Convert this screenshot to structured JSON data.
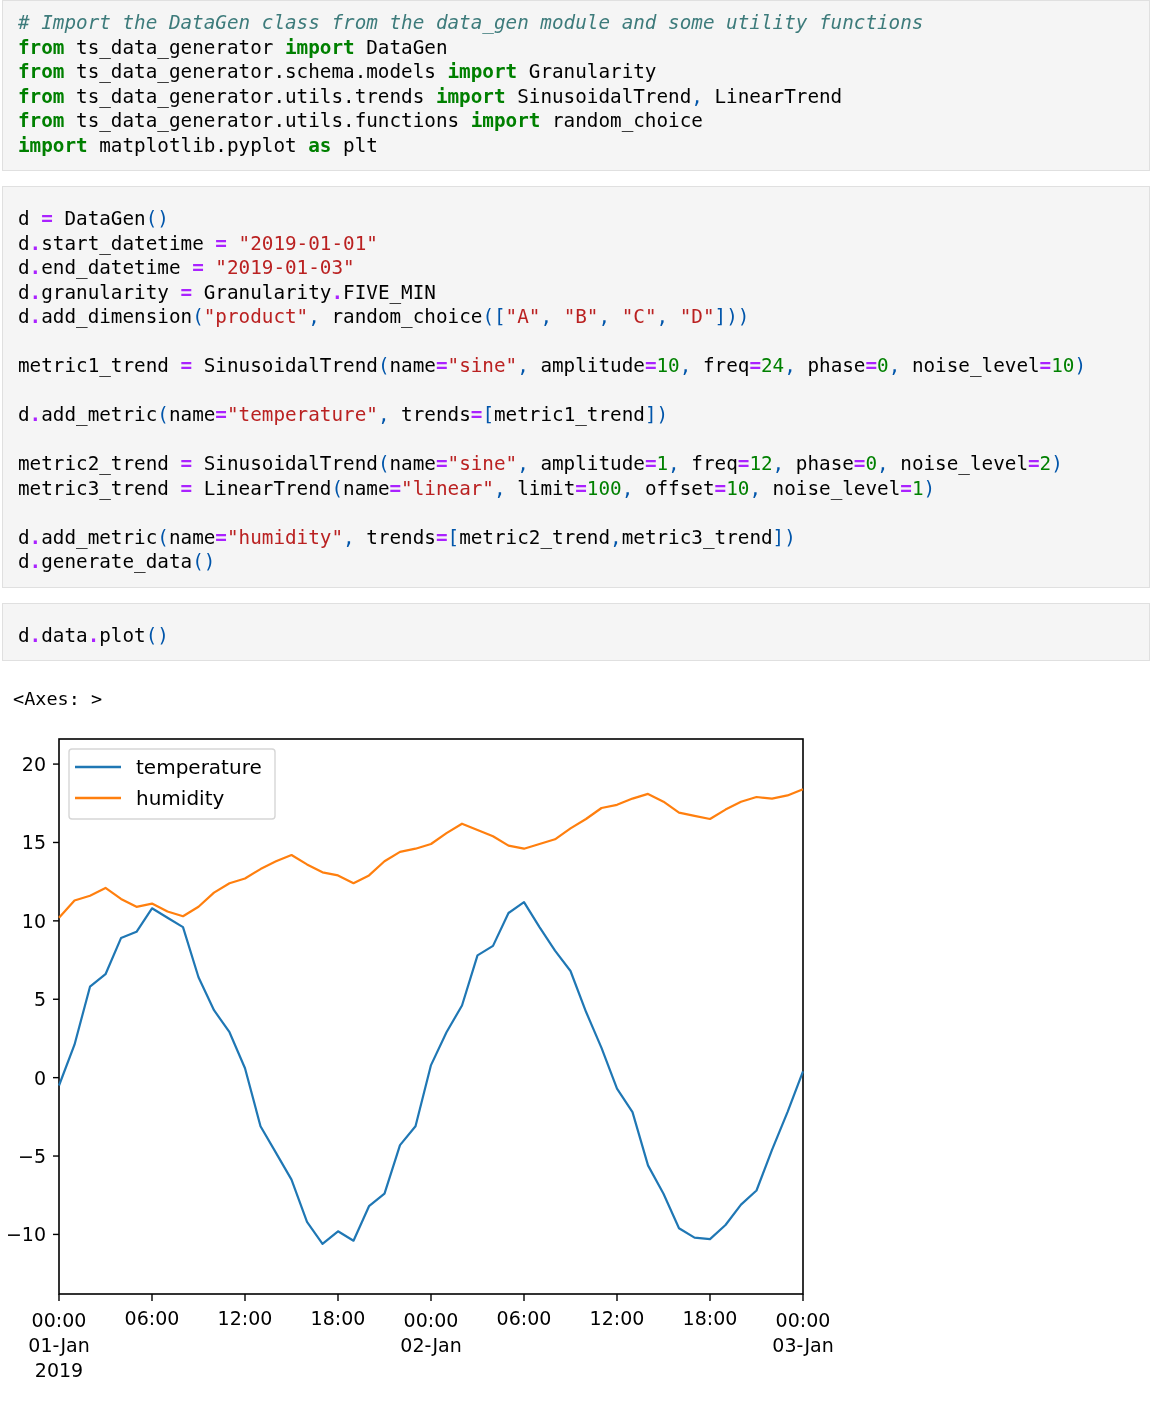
{
  "cells": [
    {
      "blocks": [
        {
          "lines": [
            [
              {
                "kind": "comment",
                "text": "# Import the DataGen class from the data_gen module and some utility functions"
              }
            ],
            [
              {
                "kind": "kw",
                "text": "from"
              },
              {
                "kind": "plain",
                "text": " ts_data_generator "
              },
              {
                "kind": "kw",
                "text": "import"
              },
              {
                "kind": "plain",
                "text": " DataGen"
              }
            ],
            [
              {
                "kind": "kw",
                "text": "from"
              },
              {
                "kind": "plain",
                "text": " ts_data_generator.schema.models "
              },
              {
                "kind": "kw",
                "text": "import"
              },
              {
                "kind": "plain",
                "text": " Granularity"
              }
            ],
            [
              {
                "kind": "kw",
                "text": "from"
              },
              {
                "kind": "plain",
                "text": " ts_data_generator.utils.trends "
              },
              {
                "kind": "kw",
                "text": "import"
              },
              {
                "kind": "plain",
                "text": " SinusoidalTrend"
              },
              {
                "kind": "paren",
                "text": ", "
              },
              {
                "kind": "plain",
                "text": "LinearTrend"
              }
            ],
            [
              {
                "kind": "kw",
                "text": "from"
              },
              {
                "kind": "plain",
                "text": " ts_data_generator.utils.functions "
              },
              {
                "kind": "kw",
                "text": "import"
              },
              {
                "kind": "plain",
                "text": " random_choice"
              }
            ],
            [
              {
                "kind": "kw",
                "text": "import"
              },
              {
                "kind": "plain",
                "text": " matplotlib.pyplot "
              },
              {
                "kind": "kw",
                "text": "as"
              },
              {
                "kind": "plain",
                "text": " plt"
              }
            ]
          ]
        }
      ]
    },
    {
      "blocks": [
        {
          "lines": [
            [
              {
                "kind": "plain",
                "text": "d "
              },
              {
                "kind": "op",
                "text": "="
              },
              {
                "kind": "plain",
                "text": " DataGen"
              },
              {
                "kind": "paren",
                "text": "()"
              }
            ],
            [
              {
                "kind": "plain",
                "text": "d"
              },
              {
                "kind": "op",
                "text": "."
              },
              {
                "kind": "plain",
                "text": "start_datetime "
              },
              {
                "kind": "op",
                "text": "="
              },
              {
                "kind": "str",
                "text": " \"2019-01-01\""
              }
            ],
            [
              {
                "kind": "plain",
                "text": "d"
              },
              {
                "kind": "op",
                "text": "."
              },
              {
                "kind": "plain",
                "text": "end_datetime "
              },
              {
                "kind": "op",
                "text": "="
              },
              {
                "kind": "str",
                "text": " \"2019-01-03\""
              }
            ],
            [
              {
                "kind": "plain",
                "text": "d"
              },
              {
                "kind": "op",
                "text": "."
              },
              {
                "kind": "plain",
                "text": "granularity "
              },
              {
                "kind": "op",
                "text": "="
              },
              {
                "kind": "plain",
                "text": " Granularity"
              },
              {
                "kind": "op",
                "text": "."
              },
              {
                "kind": "plain",
                "text": "FIVE_MIN"
              }
            ],
            [
              {
                "kind": "plain",
                "text": "d"
              },
              {
                "kind": "op",
                "text": "."
              },
              {
                "kind": "plain",
                "text": "add_dimension"
              },
              {
                "kind": "paren",
                "text": "("
              },
              {
                "kind": "str",
                "text": "\"product\""
              },
              {
                "kind": "paren",
                "text": ", "
              },
              {
                "kind": "plain",
                "text": "random_choice"
              },
              {
                "kind": "paren",
                "text": "(["
              },
              {
                "kind": "str",
                "text": "\"A\""
              },
              {
                "kind": "paren",
                "text": ", "
              },
              {
                "kind": "str",
                "text": "\"B\""
              },
              {
                "kind": "paren",
                "text": ", "
              },
              {
                "kind": "str",
                "text": "\"C\""
              },
              {
                "kind": "paren",
                "text": ", "
              },
              {
                "kind": "str",
                "text": "\"D\""
              },
              {
                "kind": "paren",
                "text": "]))"
              }
            ]
          ]
        },
        {
          "lines": [
            [
              {
                "kind": "plain",
                "text": "metric1_trend "
              },
              {
                "kind": "op",
                "text": "="
              },
              {
                "kind": "plain",
                "text": " SinusoidalTrend"
              },
              {
                "kind": "paren",
                "text": "("
              },
              {
                "kind": "plain",
                "text": "name"
              },
              {
                "kind": "op",
                "text": "="
              },
              {
                "kind": "str",
                "text": "\"sine\""
              },
              {
                "kind": "paren",
                "text": ", "
              },
              {
                "kind": "plain",
                "text": "amplitude"
              },
              {
                "kind": "op",
                "text": "="
              },
              {
                "kind": "num",
                "text": "10"
              },
              {
                "kind": "paren",
                "text": ", "
              },
              {
                "kind": "plain",
                "text": "freq"
              },
              {
                "kind": "op",
                "text": "="
              },
              {
                "kind": "num",
                "text": "24"
              },
              {
                "kind": "paren",
                "text": ", "
              },
              {
                "kind": "plain",
                "text": "phase"
              },
              {
                "kind": "op",
                "text": "="
              },
              {
                "kind": "num",
                "text": "0"
              },
              {
                "kind": "paren",
                "text": ", "
              },
              {
                "kind": "plain",
                "text": "noise_level"
              },
              {
                "kind": "op",
                "text": "="
              },
              {
                "kind": "num",
                "text": "10"
              },
              {
                "kind": "paren",
                "text": ")"
              }
            ]
          ]
        },
        {
          "lines": [
            [
              {
                "kind": "plain",
                "text": "d"
              },
              {
                "kind": "op",
                "text": "."
              },
              {
                "kind": "plain",
                "text": "add_metric"
              },
              {
                "kind": "paren",
                "text": "("
              },
              {
                "kind": "plain",
                "text": "name"
              },
              {
                "kind": "op",
                "text": "="
              },
              {
                "kind": "str",
                "text": "\"temperature\""
              },
              {
                "kind": "paren",
                "text": ", "
              },
              {
                "kind": "plain",
                "text": "trends"
              },
              {
                "kind": "op",
                "text": "="
              },
              {
                "kind": "paren",
                "text": "["
              },
              {
                "kind": "plain",
                "text": "metric1_trend"
              },
              {
                "kind": "paren",
                "text": "])"
              }
            ]
          ]
        },
        {
          "lines": [
            [
              {
                "kind": "plain",
                "text": "metric2_trend "
              },
              {
                "kind": "op",
                "text": "="
              },
              {
                "kind": "plain",
                "text": " SinusoidalTrend"
              },
              {
                "kind": "paren",
                "text": "("
              },
              {
                "kind": "plain",
                "text": "name"
              },
              {
                "kind": "op",
                "text": "="
              },
              {
                "kind": "str",
                "text": "\"sine\""
              },
              {
                "kind": "paren",
                "text": ", "
              },
              {
                "kind": "plain",
                "text": "amplitude"
              },
              {
                "kind": "op",
                "text": "="
              },
              {
                "kind": "num",
                "text": "1"
              },
              {
                "kind": "paren",
                "text": ", "
              },
              {
                "kind": "plain",
                "text": "freq"
              },
              {
                "kind": "op",
                "text": "="
              },
              {
                "kind": "num",
                "text": "12"
              },
              {
                "kind": "paren",
                "text": ", "
              },
              {
                "kind": "plain",
                "text": "phase"
              },
              {
                "kind": "op",
                "text": "="
              },
              {
                "kind": "num",
                "text": "0"
              },
              {
                "kind": "paren",
                "text": ", "
              },
              {
                "kind": "plain",
                "text": "noise_level"
              },
              {
                "kind": "op",
                "text": "="
              },
              {
                "kind": "num",
                "text": "2"
              },
              {
                "kind": "paren",
                "text": ")"
              }
            ],
            [
              {
                "kind": "plain",
                "text": "metric3_trend "
              },
              {
                "kind": "op",
                "text": "="
              },
              {
                "kind": "plain",
                "text": " LinearTrend"
              },
              {
                "kind": "paren",
                "text": "("
              },
              {
                "kind": "plain",
                "text": "name"
              },
              {
                "kind": "op",
                "text": "="
              },
              {
                "kind": "str",
                "text": "\"linear\""
              },
              {
                "kind": "paren",
                "text": ", "
              },
              {
                "kind": "plain",
                "text": "limit"
              },
              {
                "kind": "op",
                "text": "="
              },
              {
                "kind": "num",
                "text": "100"
              },
              {
                "kind": "paren",
                "text": ", "
              },
              {
                "kind": "plain",
                "text": "offset"
              },
              {
                "kind": "op",
                "text": "="
              },
              {
                "kind": "num",
                "text": "10"
              },
              {
                "kind": "paren",
                "text": ", "
              },
              {
                "kind": "plain",
                "text": "noise_level"
              },
              {
                "kind": "op",
                "text": "="
              },
              {
                "kind": "num",
                "text": "1"
              },
              {
                "kind": "paren",
                "text": ")"
              }
            ]
          ]
        },
        {
          "lines": [
            [
              {
                "kind": "plain",
                "text": "d"
              },
              {
                "kind": "op",
                "text": "."
              },
              {
                "kind": "plain",
                "text": "add_metric"
              },
              {
                "kind": "paren",
                "text": "("
              },
              {
                "kind": "plain",
                "text": "name"
              },
              {
                "kind": "op",
                "text": "="
              },
              {
                "kind": "str",
                "text": "\"humidity\""
              },
              {
                "kind": "paren",
                "text": ", "
              },
              {
                "kind": "plain",
                "text": "trends"
              },
              {
                "kind": "op",
                "text": "="
              },
              {
                "kind": "paren",
                "text": "["
              },
              {
                "kind": "plain",
                "text": "metric2_trend"
              },
              {
                "kind": "paren",
                "text": ","
              },
              {
                "kind": "plain",
                "text": "metric3_trend"
              },
              {
                "kind": "paren",
                "text": "])"
              }
            ],
            [
              {
                "kind": "plain",
                "text": "d"
              },
              {
                "kind": "op",
                "text": "."
              },
              {
                "kind": "plain",
                "text": "generate_data"
              },
              {
                "kind": "paren",
                "text": "()"
              }
            ]
          ]
        }
      ]
    },
    {
      "blocks": [
        {
          "lines": [
            [
              {
                "kind": "plain",
                "text": "d"
              },
              {
                "kind": "op",
                "text": "."
              },
              {
                "kind": "plain",
                "text": "data"
              },
              {
                "kind": "op",
                "text": "."
              },
              {
                "kind": "plain",
                "text": "plot"
              },
              {
                "kind": "paren",
                "text": "()"
              }
            ]
          ]
        }
      ]
    }
  ],
  "output": {
    "text": "<Axes: >",
    "chart_data": {
      "type": "line",
      "x": [
        "2019-01-01T00:00",
        "2019-01-01T01:00",
        "2019-01-01T02:00",
        "2019-01-01T03:00",
        "2019-01-01T04:00",
        "2019-01-01T05:00",
        "2019-01-01T06:00",
        "2019-01-01T07:00",
        "2019-01-01T08:00",
        "2019-01-01T09:00",
        "2019-01-01T10:00",
        "2019-01-01T11:00",
        "2019-01-01T12:00",
        "2019-01-01T13:00",
        "2019-01-01T14:00",
        "2019-01-01T15:00",
        "2019-01-01T16:00",
        "2019-01-01T17:00",
        "2019-01-01T18:00",
        "2019-01-01T19:00",
        "2019-01-01T20:00",
        "2019-01-01T21:00",
        "2019-01-01T22:00",
        "2019-01-01T23:00",
        "2019-01-02T00:00",
        "2019-01-02T01:00",
        "2019-01-02T02:00",
        "2019-01-02T03:00",
        "2019-01-02T04:00",
        "2019-01-02T05:00",
        "2019-01-02T06:00",
        "2019-01-02T07:00",
        "2019-01-02T08:00",
        "2019-01-02T09:00",
        "2019-01-02T10:00",
        "2019-01-02T11:00",
        "2019-01-02T12:00",
        "2019-01-02T13:00",
        "2019-01-02T14:00",
        "2019-01-02T15:00",
        "2019-01-02T16:00",
        "2019-01-02T17:00",
        "2019-01-02T18:00",
        "2019-01-02T19:00",
        "2019-01-02T20:00",
        "2019-01-02T21:00",
        "2019-01-02T22:00",
        "2019-01-02T23:00",
        "2019-01-03T00:00"
      ],
      "series": [
        {
          "name": "temperature",
          "color": "#1f77b4",
          "values": [
            -0.5,
            2.1,
            5.8,
            6.6,
            8.9,
            9.3,
            10.8,
            10.2,
            9.6,
            6.4,
            4.3,
            2.9,
            0.6,
            -3.1,
            -4.8,
            -6.5,
            -9.2,
            -10.6,
            -9.8,
            -10.4,
            -8.2,
            -7.4,
            -4.3,
            -3.1,
            0.8,
            2.9,
            4.6,
            7.8,
            8.4,
            10.5,
            11.2,
            9.6,
            8.1,
            6.8,
            4.2,
            1.9,
            -0.7,
            -2.2,
            -5.6,
            -7.4,
            -9.6,
            -10.2,
            -10.3,
            -9.4,
            -8.1,
            -7.2,
            -4.6,
            -2.2,
            0.4
          ]
        },
        {
          "name": "humidity",
          "color": "#ff7f0e",
          "values": [
            10.2,
            11.3,
            11.6,
            12.1,
            11.4,
            10.9,
            11.1,
            10.6,
            10.3,
            10.9,
            11.8,
            12.4,
            12.7,
            13.3,
            13.8,
            14.2,
            13.6,
            13.1,
            12.9,
            12.4,
            12.9,
            13.8,
            14.4,
            14.6,
            14.9,
            15.6,
            16.2,
            15.8,
            15.4,
            14.8,
            14.6,
            14.9,
            15.2,
            15.9,
            16.5,
            17.2,
            17.4,
            17.8,
            18.1,
            17.6,
            16.9,
            16.7,
            16.5,
            17.1,
            17.6,
            17.9,
            17.8,
            18.0,
            18.4
          ]
        }
      ],
      "xlim": [
        "2019-01-01T00:00",
        "2019-01-03T00:00"
      ],
      "ylim": [
        -13.8,
        21.6
      ],
      "xticks": [
        {
          "value": "2019-01-01T00:00",
          "label": "00:00\n01-Jan\n2019"
        },
        {
          "value": "2019-01-01T06:00",
          "label": "06:00"
        },
        {
          "value": "2019-01-01T12:00",
          "label": "12:00"
        },
        {
          "value": "2019-01-01T18:00",
          "label": "18:00"
        },
        {
          "value": "2019-01-02T00:00",
          "label": "00:00\n02-Jan"
        },
        {
          "value": "2019-01-02T06:00",
          "label": "06:00"
        },
        {
          "value": "2019-01-02T12:00",
          "label": "12:00"
        },
        {
          "value": "2019-01-02T18:00",
          "label": "18:00"
        },
        {
          "value": "2019-01-03T00:00",
          "label": "00:00\n03-Jan"
        }
      ],
      "yticks": [
        {
          "value": -10,
          "label": "−10"
        },
        {
          "value": -5,
          "label": "−5"
        },
        {
          "value": 0,
          "label": "0"
        },
        {
          "value": 5,
          "label": "5"
        },
        {
          "value": 10,
          "label": "10"
        },
        {
          "value": 15,
          "label": "15"
        },
        {
          "value": 20,
          "label": "20"
        }
      ],
      "legend": true
    }
  }
}
